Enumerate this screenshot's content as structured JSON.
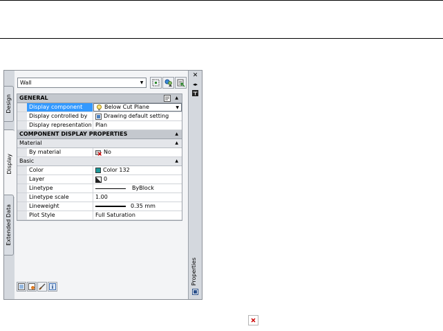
{
  "object_type_value": "Wall",
  "tabs": [
    {
      "label": "Design"
    },
    {
      "label": "Display"
    },
    {
      "label": "Extended Data"
    }
  ],
  "palette_title": "Properties",
  "sections": {
    "general": {
      "title": "GENERAL",
      "rows": [
        {
          "name": "Display component",
          "value": "Below Cut Plane"
        },
        {
          "name": "Display controlled by",
          "value": "Drawing default setting"
        },
        {
          "name": "Display representation",
          "value": "Plan"
        }
      ]
    },
    "component": {
      "title": "COMPONENT DISPLAY PROPERTIES",
      "material": {
        "title": "Material",
        "rows": [
          {
            "name": "By material",
            "value": "No"
          }
        ]
      },
      "basic": {
        "title": "Basic",
        "rows": [
          {
            "name": "Color",
            "value": "Color 132"
          },
          {
            "name": "Layer",
            "value": "0"
          },
          {
            "name": "Linetype",
            "value": "ByBlock"
          },
          {
            "name": "Linetype scale",
            "value": "1.00"
          },
          {
            "name": "Lineweight",
            "value": "0.35 mm"
          },
          {
            "name": "Plot Style",
            "value": "Full Saturation"
          }
        ]
      }
    }
  },
  "colors": {
    "selected_row": "#3399ff",
    "color_swatch": "#1f9a9a",
    "section_header": "#c4c8ce"
  },
  "icons": [
    "select-objects-icon",
    "quick-select-icon",
    "pickadd-icon",
    "close-icon",
    "autohide-icon",
    "palette-menu-icon",
    "broken-image-icon"
  ]
}
